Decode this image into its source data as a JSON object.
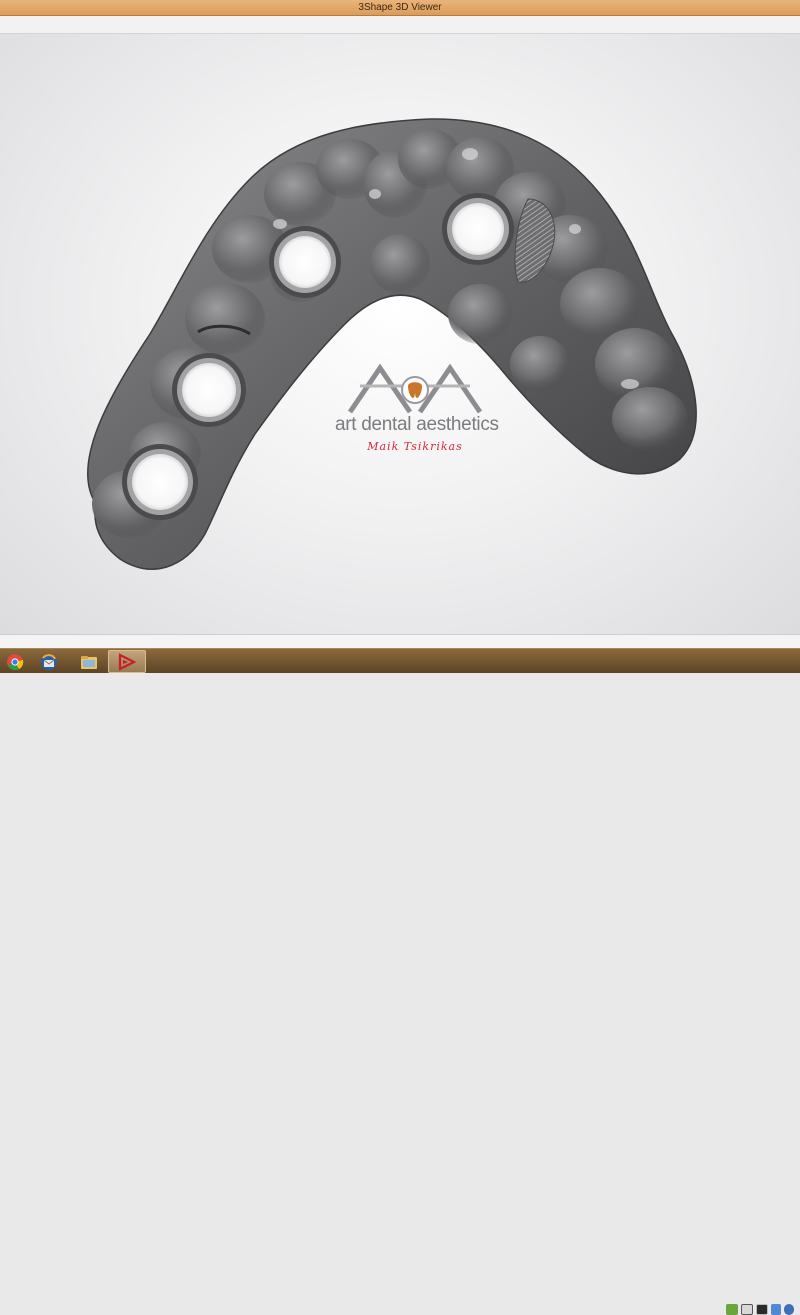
{
  "window": {
    "title": "3Shape 3D Viewer"
  },
  "watermark": {
    "text": "art dental aesthetics",
    "subtitle": "Maik Tsikrikas"
  },
  "taskbar": {
    "apps": [
      {
        "name": "chrome-icon"
      },
      {
        "name": "thunderbird-icon"
      },
      {
        "name": "file-explorer-icon"
      },
      {
        "name": "3shape-viewer-icon",
        "active": true
      }
    ],
    "tray": [
      "nvidia-icon",
      "monitor-icon",
      "display-icon",
      "network-icon",
      "shield-icon",
      "volume-icon"
    ]
  },
  "colors": {
    "titlebar": "#dc9c58",
    "taskbar": "#6e5230",
    "model": "#6b6b6d",
    "logo_red": "#d7283a"
  }
}
